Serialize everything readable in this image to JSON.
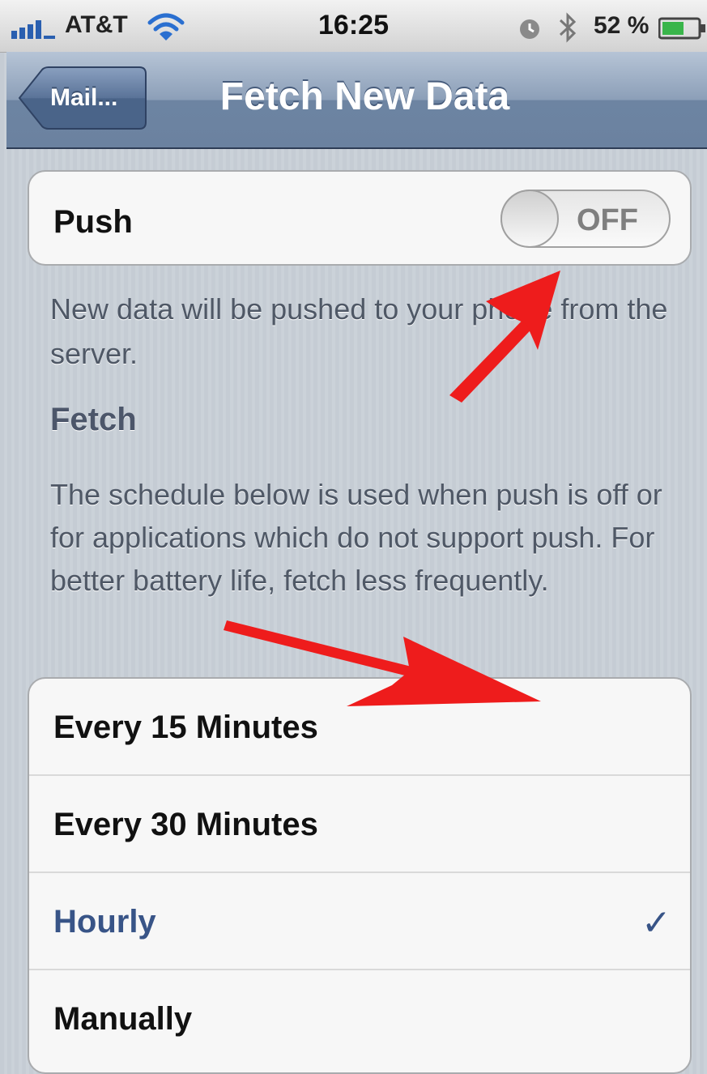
{
  "status_bar": {
    "carrier": "AT&T",
    "time": "16:25",
    "battery_percent": "52 %",
    "icons": [
      "signal-bars-icon",
      "wifi-icon",
      "clock-icon",
      "bluetooth-icon",
      "battery-icon"
    ]
  },
  "nav": {
    "back_label": "Mail...",
    "title": "Fetch New Data"
  },
  "push": {
    "label": "Push",
    "toggle_state": "OFF",
    "footer": "New data will be pushed to your phone from the server."
  },
  "fetch": {
    "header": "Fetch",
    "description": "The schedule below is used when push is off or for applications which do not support push. For better battery life, fetch less frequently.",
    "options": [
      {
        "label": "Every 15 Minutes",
        "selected": false
      },
      {
        "label": "Every 30 Minutes",
        "selected": false
      },
      {
        "label": "Hourly",
        "selected": true
      },
      {
        "label": "Manually",
        "selected": false
      }
    ],
    "checkmark": "✓"
  },
  "colors": {
    "annotation_arrow": "#ee1c1c",
    "selected_text": "#385487",
    "nav_bar": "#6d84a2"
  }
}
